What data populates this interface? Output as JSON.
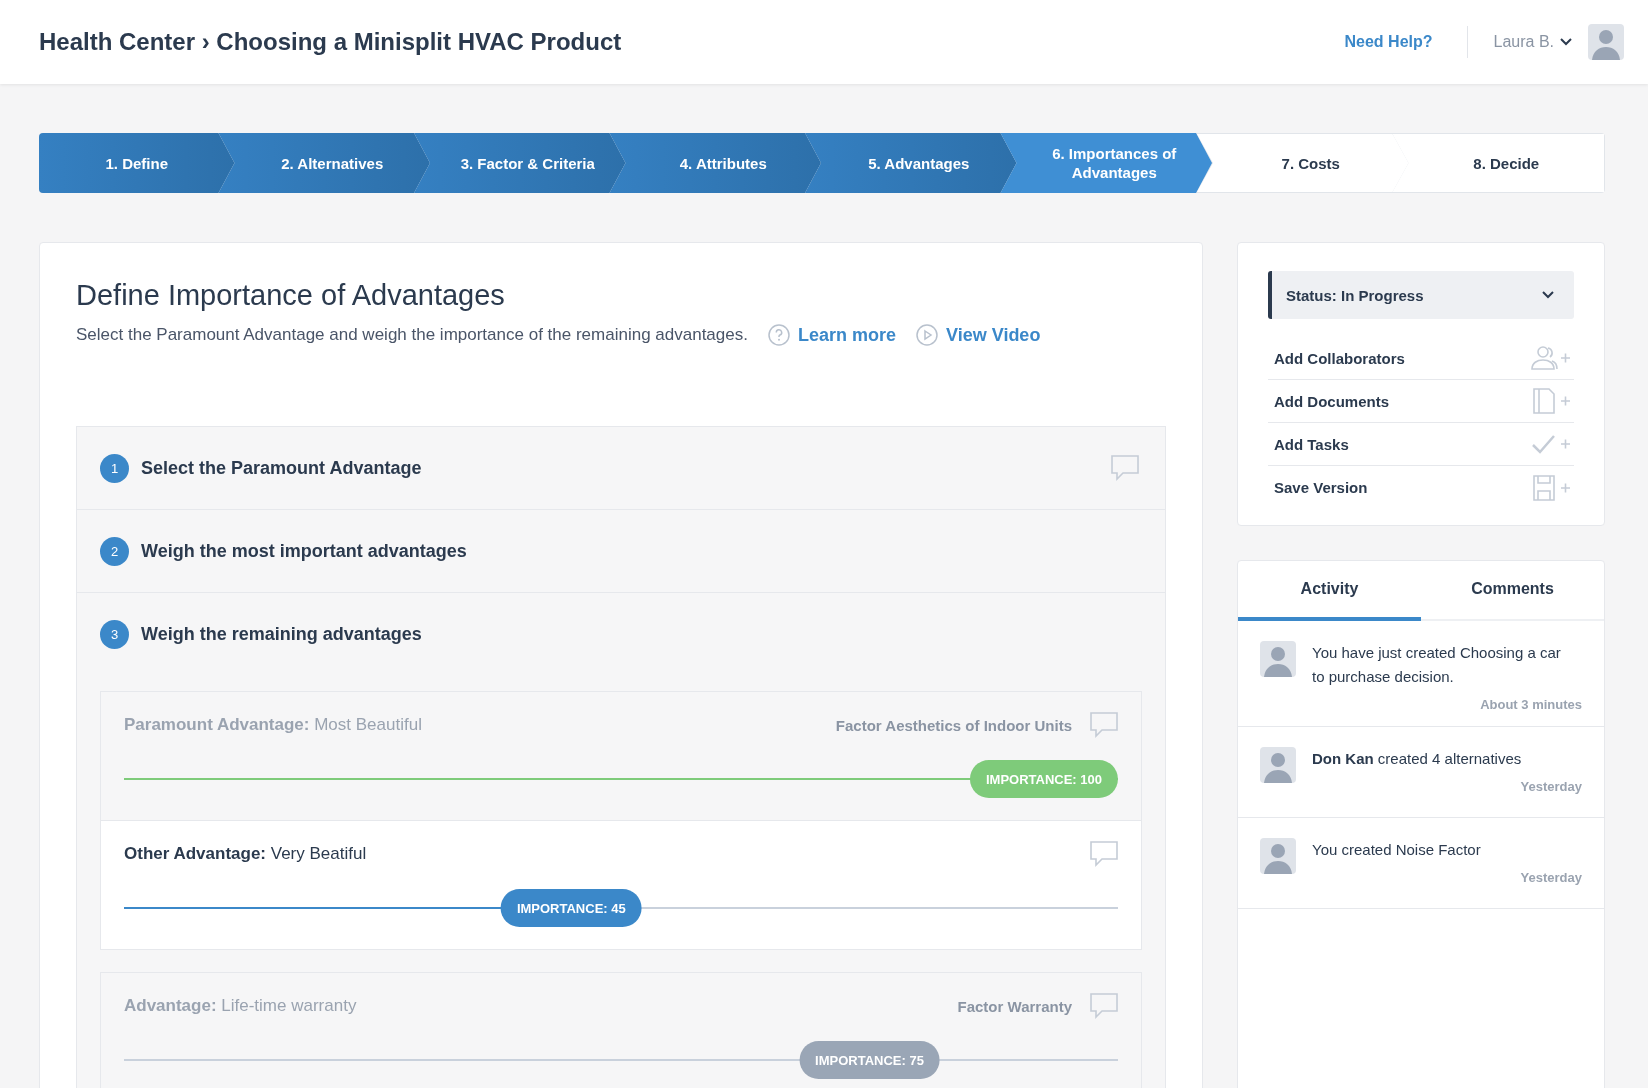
{
  "header": {
    "breadcrumb": "Health Center › Choosing a Minisplit HVAC Product",
    "help_link": "Need Help?",
    "user": "Laura B."
  },
  "steps": [
    {
      "label": "1. Define",
      "completed": true,
      "selected": false
    },
    {
      "label": "2. Alternatives",
      "completed": true,
      "selected": false
    },
    {
      "label": "3. Factor & Criteria",
      "completed": true,
      "selected": false
    },
    {
      "label": "4. Attributes",
      "completed": true,
      "selected": false
    },
    {
      "label": "5. Advantages",
      "completed": true,
      "selected": false
    },
    {
      "label": "6. Importances of Advantages",
      "completed": false,
      "selected": true
    },
    {
      "label": "7. Costs",
      "completed": false,
      "selected": false
    },
    {
      "label": "8. Decide",
      "completed": false,
      "selected": false
    }
  ],
  "main": {
    "title": "Define Importance of Advantages",
    "description": "Select the Paramount Advantage and weigh the importance of the remaining advantages.",
    "learn_more": "Learn more",
    "view_video": "View Video",
    "sections": [
      {
        "number": "1",
        "title": "Select the Paramount Advantage",
        "comment_icon": true
      },
      {
        "number": "2",
        "title": "Weigh the most important advantages",
        "comment_icon": false
      },
      {
        "number": "3",
        "title": "Weigh the remaining advantages",
        "comment_icon": false
      }
    ],
    "advantages": [
      {
        "kind": "paramount",
        "label": "Paramount Advantage:",
        "value": "Most Beautiful",
        "factor": "Factor Aesthetics of Indoor Units",
        "importance": "IMPORTANCE: 100",
        "level": 1
      },
      {
        "kind": "active",
        "label": "Other Advantage:",
        "value": "Very Beatiful",
        "importance": "IMPORTANCE: 45",
        "level": 0.45
      },
      {
        "kind": "inactive",
        "label": "Advantage:",
        "value": "Life-time warranty",
        "factor": "Factor Warranty",
        "importance": "IMPORTANCE: 75",
        "level": 0.75
      }
    ]
  },
  "sidebar": {
    "status": "Status: In Progress",
    "actions": [
      {
        "label": "Add Collaborators",
        "kind": "people"
      },
      {
        "label": "Add Documents",
        "kind": "document"
      },
      {
        "label": "Add Tasks",
        "kind": "check"
      },
      {
        "label": "Save Version",
        "kind": "save"
      }
    ],
    "tabs": [
      {
        "label": "Activity",
        "selected": true
      },
      {
        "label": "Comments",
        "selected": false
      }
    ],
    "activity": [
      {
        "text": "You have just created Choosing a car to purchase decision.",
        "time": "About 3 minutes"
      },
      {
        "actor": "Don Kan",
        "text": "created 4 alternatives",
        "time": "Yesterday"
      },
      {
        "text": "You created Noise Factor",
        "time": "Yesterday"
      }
    ]
  }
}
